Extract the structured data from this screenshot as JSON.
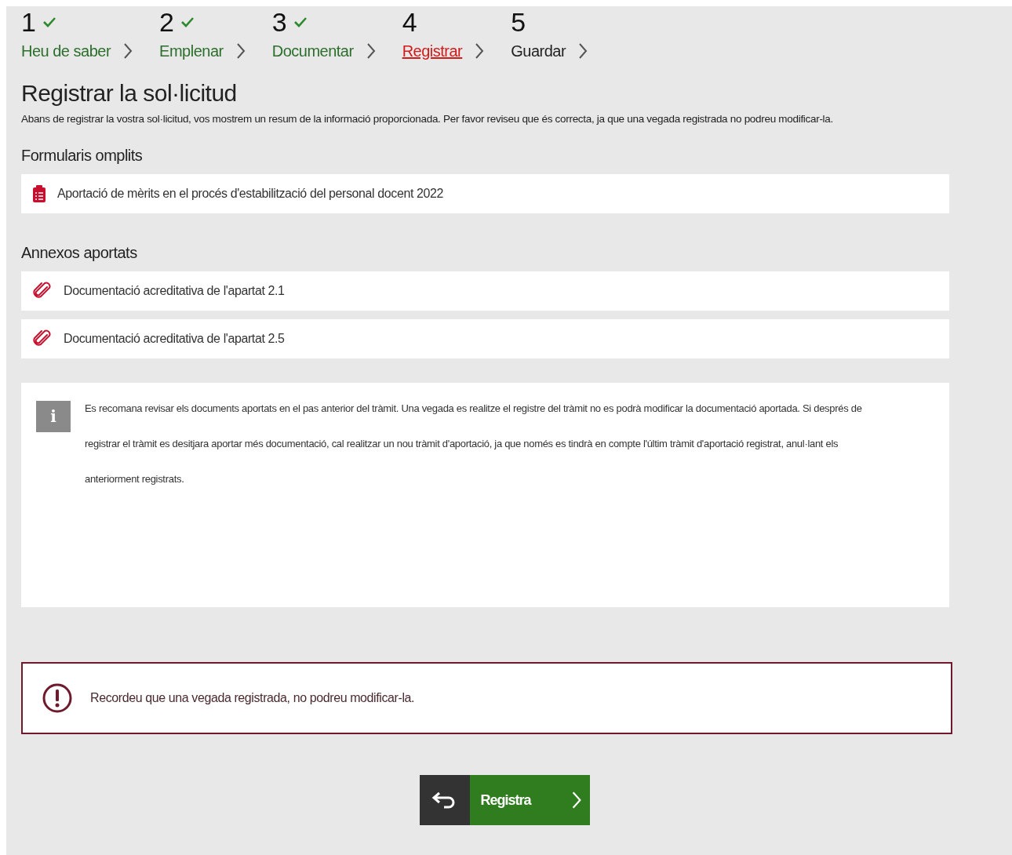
{
  "steps": [
    {
      "number": "1",
      "label": "Heu de saber",
      "completed": true,
      "selected": false
    },
    {
      "number": "2",
      "label": "Emplenar",
      "completed": true,
      "selected": false
    },
    {
      "number": "3",
      "label": "Documentar",
      "completed": true,
      "selected": false
    },
    {
      "number": "4",
      "label": "Registrar",
      "completed": false,
      "selected": true
    },
    {
      "number": "5",
      "label": "Guardar",
      "completed": false,
      "selected": false
    }
  ],
  "title": "Registrar la sol·licitud",
  "description": "Abans de registrar la vostra sol·licitud, vos mostrem un resum de la informació proporcionada. Per favor reviseu que és correcta, ja que una vegada registrada no podreu modificar-la.",
  "sections": [
    {
      "heading": "Formularis omplits",
      "items": [
        {
          "kind": "form",
          "label": "Aportació de mèrits en el procés d'estabilització del personal docent 2022"
        }
      ]
    },
    {
      "heading": "Annexos aportats",
      "items": [
        {
          "kind": "attachment",
          "label": "Documentació acreditativa de l'apartat 2.1"
        },
        {
          "kind": "attachment",
          "label": "Documentació acreditativa de l'apartat 2.5"
        }
      ]
    }
  ],
  "info": {
    "icon": "i",
    "text": "Es recomana revisar els documents aportats en el pas anterior del tràmit. Una vegada es realitze el registre del tràmit no es podrà modificar la documentació aportada. Si després de registrar el tràmit es desitjara aportar més documentació, cal realitzar un nou tràmit d'aportació, ja que només es tindrà en compte l'últim tràmit d'aportació registrat, anul·lant els anteriorment registrats."
  },
  "alert": {
    "text": "Recordeu que una vegada registrada, no podreu modificar-la."
  },
  "submit_button": {
    "label": "Registra"
  }
}
